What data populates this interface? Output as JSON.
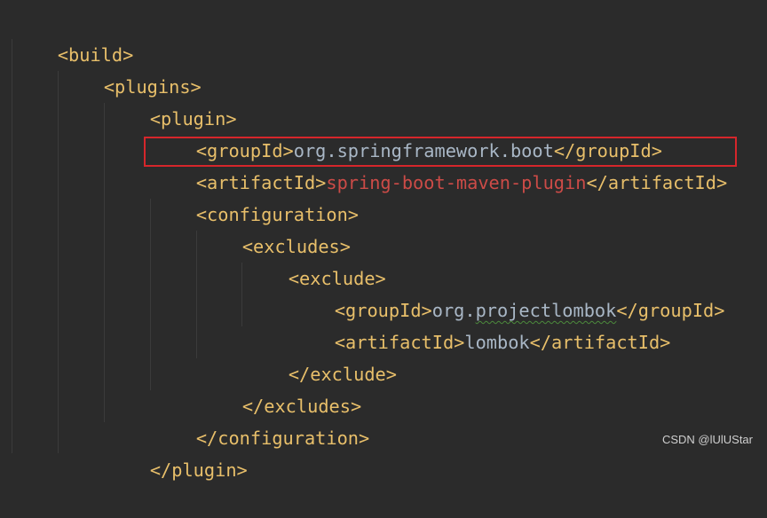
{
  "colors": {
    "background": "#2b2b2b",
    "tag": "#e8bf6a",
    "text": "#a9b7c6",
    "highlight_text": "#cc4b47",
    "highlight_box": "#d6262b"
  },
  "code": {
    "lines": [
      {
        "open": "<build>"
      },
      {
        "open": "<plugins>"
      },
      {
        "open": "<plugin>"
      },
      {
        "open": "<groupId>",
        "value": "org.springframework.boot",
        "close": "</groupId>"
      },
      {
        "open": "<artifactId>",
        "value": "spring-boot-maven-plugin",
        "close": "</artifactId>"
      },
      {
        "open": "<configuration>"
      },
      {
        "open": "<excludes>"
      },
      {
        "open": "<exclude>"
      },
      {
        "open": "<groupId>",
        "value_prefix": "org.",
        "value_squiggle": "projectlombok",
        "close": "</groupId>"
      },
      {
        "open": "<artifactId>",
        "value": "lombok",
        "close": "</artifactId>"
      },
      {
        "open": "</exclude>"
      },
      {
        "open": "</excludes>"
      },
      {
        "open": "</configuration>"
      },
      {
        "open": "</plugin>"
      }
    ]
  },
  "watermark": "CSDN @lUlUStar"
}
